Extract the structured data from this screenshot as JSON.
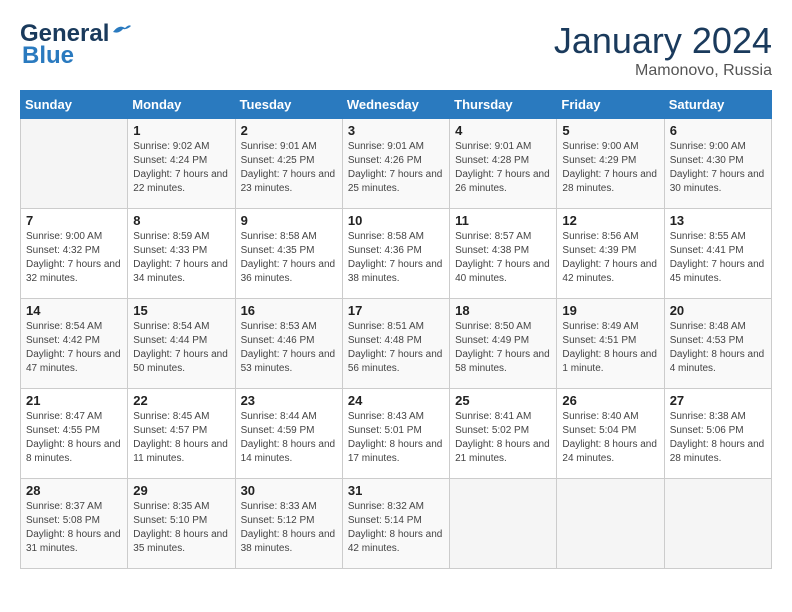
{
  "header": {
    "logo_line1": "General",
    "logo_line2": "Blue",
    "month_title": "January 2024",
    "subtitle": "Mamonovo, Russia"
  },
  "weekdays": [
    "Sunday",
    "Monday",
    "Tuesday",
    "Wednesday",
    "Thursday",
    "Friday",
    "Saturday"
  ],
  "weeks": [
    [
      {
        "day": "",
        "sunrise": "",
        "sunset": "",
        "daylight": ""
      },
      {
        "day": "1",
        "sunrise": "Sunrise: 9:02 AM",
        "sunset": "Sunset: 4:24 PM",
        "daylight": "Daylight: 7 hours and 22 minutes."
      },
      {
        "day": "2",
        "sunrise": "Sunrise: 9:01 AM",
        "sunset": "Sunset: 4:25 PM",
        "daylight": "Daylight: 7 hours and 23 minutes."
      },
      {
        "day": "3",
        "sunrise": "Sunrise: 9:01 AM",
        "sunset": "Sunset: 4:26 PM",
        "daylight": "Daylight: 7 hours and 25 minutes."
      },
      {
        "day": "4",
        "sunrise": "Sunrise: 9:01 AM",
        "sunset": "Sunset: 4:28 PM",
        "daylight": "Daylight: 7 hours and 26 minutes."
      },
      {
        "day": "5",
        "sunrise": "Sunrise: 9:00 AM",
        "sunset": "Sunset: 4:29 PM",
        "daylight": "Daylight: 7 hours and 28 minutes."
      },
      {
        "day": "6",
        "sunrise": "Sunrise: 9:00 AM",
        "sunset": "Sunset: 4:30 PM",
        "daylight": "Daylight: 7 hours and 30 minutes."
      }
    ],
    [
      {
        "day": "7",
        "sunrise": "Sunrise: 9:00 AM",
        "sunset": "Sunset: 4:32 PM",
        "daylight": "Daylight: 7 hours and 32 minutes."
      },
      {
        "day": "8",
        "sunrise": "Sunrise: 8:59 AM",
        "sunset": "Sunset: 4:33 PM",
        "daylight": "Daylight: 7 hours and 34 minutes."
      },
      {
        "day": "9",
        "sunrise": "Sunrise: 8:58 AM",
        "sunset": "Sunset: 4:35 PM",
        "daylight": "Daylight: 7 hours and 36 minutes."
      },
      {
        "day": "10",
        "sunrise": "Sunrise: 8:58 AM",
        "sunset": "Sunset: 4:36 PM",
        "daylight": "Daylight: 7 hours and 38 minutes."
      },
      {
        "day": "11",
        "sunrise": "Sunrise: 8:57 AM",
        "sunset": "Sunset: 4:38 PM",
        "daylight": "Daylight: 7 hours and 40 minutes."
      },
      {
        "day": "12",
        "sunrise": "Sunrise: 8:56 AM",
        "sunset": "Sunset: 4:39 PM",
        "daylight": "Daylight: 7 hours and 42 minutes."
      },
      {
        "day": "13",
        "sunrise": "Sunrise: 8:55 AM",
        "sunset": "Sunset: 4:41 PM",
        "daylight": "Daylight: 7 hours and 45 minutes."
      }
    ],
    [
      {
        "day": "14",
        "sunrise": "Sunrise: 8:54 AM",
        "sunset": "Sunset: 4:42 PM",
        "daylight": "Daylight: 7 hours and 47 minutes."
      },
      {
        "day": "15",
        "sunrise": "Sunrise: 8:54 AM",
        "sunset": "Sunset: 4:44 PM",
        "daylight": "Daylight: 7 hours and 50 minutes."
      },
      {
        "day": "16",
        "sunrise": "Sunrise: 8:53 AM",
        "sunset": "Sunset: 4:46 PM",
        "daylight": "Daylight: 7 hours and 53 minutes."
      },
      {
        "day": "17",
        "sunrise": "Sunrise: 8:51 AM",
        "sunset": "Sunset: 4:48 PM",
        "daylight": "Daylight: 7 hours and 56 minutes."
      },
      {
        "day": "18",
        "sunrise": "Sunrise: 8:50 AM",
        "sunset": "Sunset: 4:49 PM",
        "daylight": "Daylight: 7 hours and 58 minutes."
      },
      {
        "day": "19",
        "sunrise": "Sunrise: 8:49 AM",
        "sunset": "Sunset: 4:51 PM",
        "daylight": "Daylight: 8 hours and 1 minute."
      },
      {
        "day": "20",
        "sunrise": "Sunrise: 8:48 AM",
        "sunset": "Sunset: 4:53 PM",
        "daylight": "Daylight: 8 hours and 4 minutes."
      }
    ],
    [
      {
        "day": "21",
        "sunrise": "Sunrise: 8:47 AM",
        "sunset": "Sunset: 4:55 PM",
        "daylight": "Daylight: 8 hours and 8 minutes."
      },
      {
        "day": "22",
        "sunrise": "Sunrise: 8:45 AM",
        "sunset": "Sunset: 4:57 PM",
        "daylight": "Daylight: 8 hours and 11 minutes."
      },
      {
        "day": "23",
        "sunrise": "Sunrise: 8:44 AM",
        "sunset": "Sunset: 4:59 PM",
        "daylight": "Daylight: 8 hours and 14 minutes."
      },
      {
        "day": "24",
        "sunrise": "Sunrise: 8:43 AM",
        "sunset": "Sunset: 5:01 PM",
        "daylight": "Daylight: 8 hours and 17 minutes."
      },
      {
        "day": "25",
        "sunrise": "Sunrise: 8:41 AM",
        "sunset": "Sunset: 5:02 PM",
        "daylight": "Daylight: 8 hours and 21 minutes."
      },
      {
        "day": "26",
        "sunrise": "Sunrise: 8:40 AM",
        "sunset": "Sunset: 5:04 PM",
        "daylight": "Daylight: 8 hours and 24 minutes."
      },
      {
        "day": "27",
        "sunrise": "Sunrise: 8:38 AM",
        "sunset": "Sunset: 5:06 PM",
        "daylight": "Daylight: 8 hours and 28 minutes."
      }
    ],
    [
      {
        "day": "28",
        "sunrise": "Sunrise: 8:37 AM",
        "sunset": "Sunset: 5:08 PM",
        "daylight": "Daylight: 8 hours and 31 minutes."
      },
      {
        "day": "29",
        "sunrise": "Sunrise: 8:35 AM",
        "sunset": "Sunset: 5:10 PM",
        "daylight": "Daylight: 8 hours and 35 minutes."
      },
      {
        "day": "30",
        "sunrise": "Sunrise: 8:33 AM",
        "sunset": "Sunset: 5:12 PM",
        "daylight": "Daylight: 8 hours and 38 minutes."
      },
      {
        "day": "31",
        "sunrise": "Sunrise: 8:32 AM",
        "sunset": "Sunset: 5:14 PM",
        "daylight": "Daylight: 8 hours and 42 minutes."
      },
      {
        "day": "",
        "sunrise": "",
        "sunset": "",
        "daylight": ""
      },
      {
        "day": "",
        "sunrise": "",
        "sunset": "",
        "daylight": ""
      },
      {
        "day": "",
        "sunrise": "",
        "sunset": "",
        "daylight": ""
      }
    ]
  ]
}
